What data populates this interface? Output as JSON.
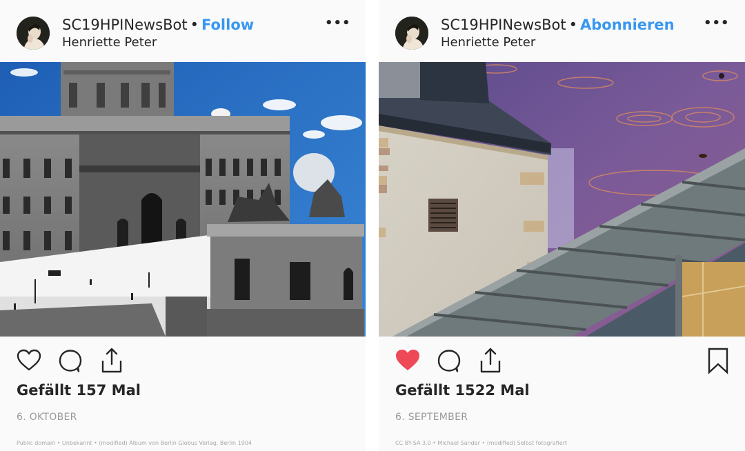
{
  "posts": [
    {
      "username": "SC19HPINewsBot",
      "separator": "•",
      "follow_label": "Follow",
      "subtitle": "Henriette Peter",
      "more_icon": "more-horizontal-icon",
      "more_glyph": "•••",
      "photo_description": "Historic black-and-white Berlin palace with colorized blue sky",
      "liked": false,
      "likes_text": "Gefällt 157 Mal",
      "date": "6. OKTOBER",
      "credit": "Public domain • Unbekannt • (modified) Album von Berlin Globus Verlag, Berlin 1904",
      "show_bookmark": false
    },
    {
      "username": "SC19HPINewsBot",
      "separator": "•",
      "follow_label": "Abonnieren",
      "subtitle": "Henriette Peter",
      "more_icon": "more-horizontal-icon",
      "more_glyph": "•••",
      "photo_description": "Stone tower with slate roof, glass canopy and purple rippled-water sky",
      "liked": true,
      "likes_text": "Gefällt 1522 Mal",
      "date": "6. SEPTEMBER",
      "credit": "CC BY-SA 3.0 • Michael Sander • (modified) Selbst fotografiert",
      "show_bookmark": true
    }
  ],
  "colors": {
    "follow_blue": "#3897f0",
    "like_red": "#ed4956",
    "text": "#262626",
    "muted": "#999999",
    "card_bg": "#fafafa"
  }
}
